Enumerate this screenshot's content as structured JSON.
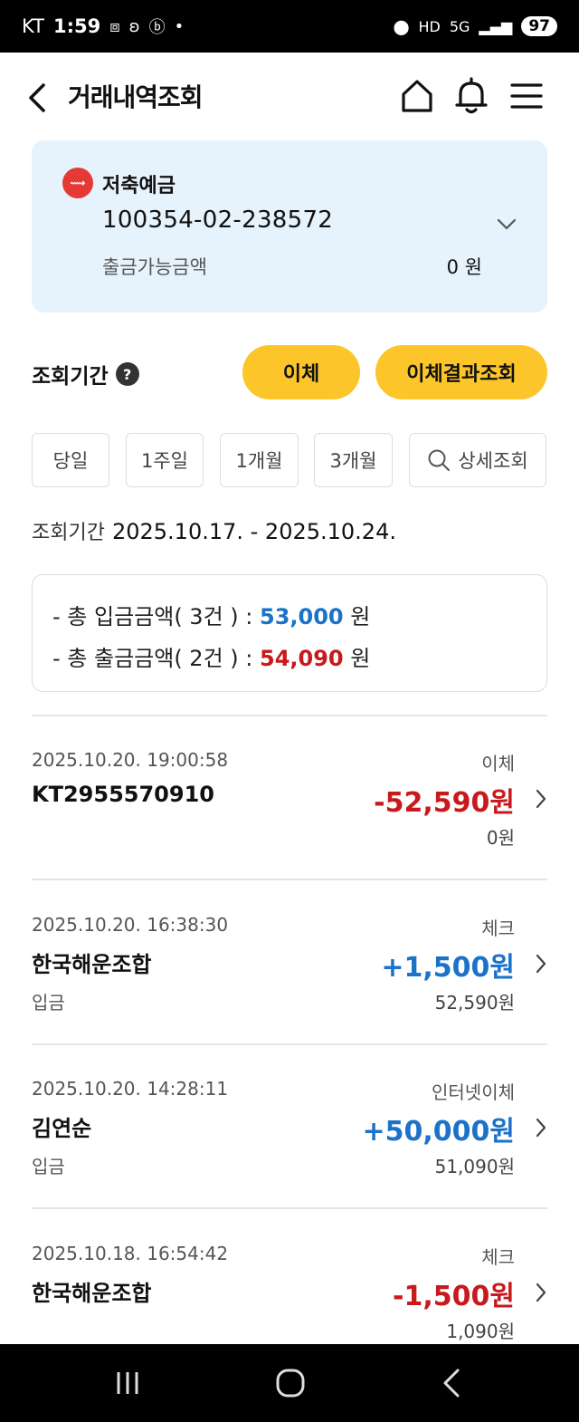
{
  "status_bar": {
    "carrier": "KT",
    "time": "1:59",
    "battery": "97"
  },
  "header": {
    "title": "거래내역조회"
  },
  "account": {
    "type": "저축예금",
    "number": "100354-02-238572",
    "balance_label": "출금가능금액",
    "balance_value": "0 원"
  },
  "period": {
    "title": "조회기간",
    "help": "?",
    "transfer_label": "이체",
    "result_label": "이체결과조회",
    "filters": [
      "당일",
      "1주일",
      "1개월",
      "3개월"
    ],
    "detail_label": "상세조회",
    "range_label": "조회기간",
    "range_value": "2025.10.17. - 2025.10.24."
  },
  "summary": {
    "deposit_prefix": "- 총 입금금액( 3건 ) : ",
    "deposit_amount": "53,000",
    "withdraw_prefix": "- 총 출금금액( 2건 ) : ",
    "withdraw_amount": "54,090",
    "unit": " 원"
  },
  "transactions": [
    {
      "datetime": "2025.10.20. 19:00:58",
      "type": "이체",
      "name": "KT2955570910",
      "amount": "-52,590원",
      "sub": "",
      "balance": "0원",
      "direction": "out"
    },
    {
      "datetime": "2025.10.20. 16:38:30",
      "type": "체크",
      "name": "한국해운조합",
      "amount": "+1,500원",
      "sub": "입금",
      "balance": "52,590원",
      "direction": "in"
    },
    {
      "datetime": "2025.10.20. 14:28:11",
      "type": "인터넷이체",
      "name": "김연순",
      "amount": "+50,000원",
      "sub": "입금",
      "balance": "51,090원",
      "direction": "in"
    },
    {
      "datetime": "2025.10.18. 16:54:42",
      "type": "체크",
      "name": "한국해운조합",
      "amount": "-1,500원",
      "sub": "",
      "balance": "1,090원",
      "direction": "out"
    }
  ],
  "colors": {
    "accent_yellow": "#fcc62a",
    "card_blue": "#e6f2fc",
    "deposit_blue": "#1a73c8",
    "withdraw_red": "#c8191d"
  }
}
